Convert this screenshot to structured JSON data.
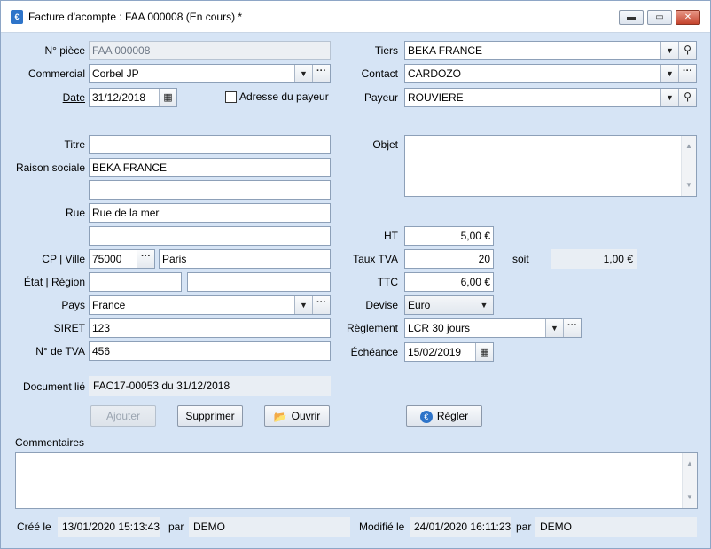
{
  "window": {
    "title": "Facture d'acompte : FAA 000008 (En cours) *",
    "controls": {
      "minimize": "▬",
      "restore": "▭",
      "close": "✕"
    }
  },
  "left": {
    "piece_label": "N° pièce",
    "piece_value": "FAA 000008",
    "commercial_label": "Commercial",
    "commercial_value": "Corbel JP",
    "date_label": "Date",
    "date_value": "31/12/2018",
    "adresse_payeur_label": "Adresse du payeur",
    "titre_label": "Titre",
    "titre_value": "",
    "raison_label": "Raison sociale",
    "raison_value": "BEKA FRANCE",
    "raison2_value": "",
    "rue_label": "Rue",
    "rue_value": "Rue de la mer",
    "rue2_value": "",
    "cpville_label": "CP | Ville",
    "cp_value": "75000",
    "ville_value": "Paris",
    "etat_label": "État | Région",
    "etat_value": "",
    "region_value": "",
    "pays_label": "Pays",
    "pays_value": "France",
    "siret_label": "SIRET",
    "siret_value": "123",
    "tva_label": "N° de TVA",
    "tva_value": "456",
    "doclie_label": "Document lié",
    "doclie_value": "FAC17-00053 du 31/12/2018"
  },
  "right": {
    "tiers_label": "Tiers",
    "tiers_value": "BEKA FRANCE",
    "contact_label": "Contact",
    "contact_value": "CARDOZO",
    "payeur_label": "Payeur",
    "payeur_value": "ROUVIERE",
    "objet_label": "Objet",
    "objet_value": "",
    "ht_label": "HT",
    "ht_value": "5,00 €",
    "tauxtva_label": "Taux TVA",
    "tauxtva_value": "20",
    "soit_label": "soit",
    "soit_value": "1,00 €",
    "ttc_label": "TTC",
    "ttc_value": "6,00 €",
    "devise_label": "Devise",
    "devise_value": "Euro",
    "reglement_label": "Règlement",
    "reglement_value": "LCR 30 jours",
    "echeance_label": "Échéance",
    "echeance_value": "15/02/2019"
  },
  "buttons": {
    "ajouter": "Ajouter",
    "supprimer": "Supprimer",
    "ouvrir": "Ouvrir",
    "regler": "Régler"
  },
  "comments": {
    "label": "Commentaires",
    "value": ""
  },
  "footer": {
    "cree_label": "Créé le",
    "cree_value": "13/01/2020 15:13:43",
    "par_label": "par",
    "cree_par_value": "DEMO",
    "modifie_label": "Modifié le",
    "modifie_value": "24/01/2020 16:11:23",
    "modifie_par_value": "DEMO"
  },
  "glyphs": {
    "dropdown": "▼",
    "ellipsis": "···",
    "search": "⚲",
    "calendar": "▦",
    "scroll_up": "▲",
    "scroll_down": "▼",
    "folder": "📂",
    "euro_badge": "€"
  }
}
